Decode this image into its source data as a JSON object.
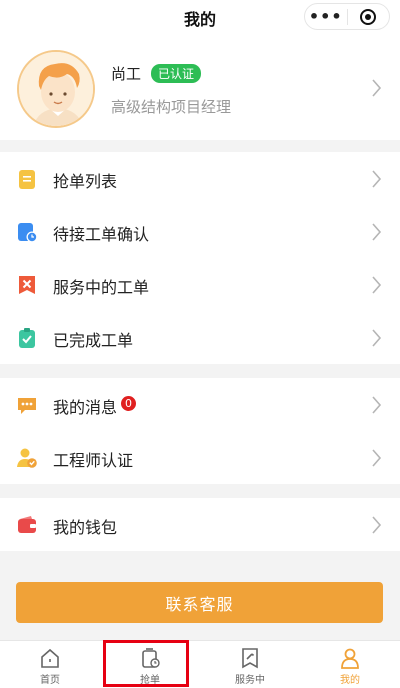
{
  "nav": {
    "title": "我的",
    "more_icon": "more-dots-icon",
    "close_icon": "target-circle-icon"
  },
  "profile": {
    "name": "尚工",
    "badge": "已认证",
    "title": "高级结构项目经理",
    "avatar_icon": "engineer-avatar-icon"
  },
  "menu_group1": [
    {
      "label": "抢单列表",
      "icon": "clipboard-list-icon",
      "color": "#f5c342"
    },
    {
      "label": "待接工单确认",
      "icon": "clock-clipboard-icon",
      "color": "#3b8df1"
    },
    {
      "label": "服务中的工单",
      "icon": "tools-cross-icon",
      "color": "#ee5a3a"
    },
    {
      "label": "已完成工单",
      "icon": "check-clipboard-icon",
      "color": "#3cc6a0"
    }
  ],
  "menu_group2": [
    {
      "label": "我的消息",
      "icon": "message-bubble-icon",
      "color": "#f0a238",
      "badge": "0"
    },
    {
      "label": "工程师认证",
      "icon": "user-verify-icon",
      "color": "#f5c342"
    }
  ],
  "menu_group3": [
    {
      "label": "我的钱包",
      "icon": "wallet-icon",
      "color": "#e94a4a"
    }
  ],
  "service_button": "联系客服",
  "tabs": [
    {
      "label": "首页",
      "icon": "home-icon"
    },
    {
      "label": "抢单",
      "icon": "grab-order-icon"
    },
    {
      "label": "服务中",
      "icon": "service-tools-icon"
    },
    {
      "label": "我的",
      "icon": "user-icon",
      "active": true
    }
  ],
  "colors": {
    "accent": "#f0a238",
    "verified": "#2dbd55",
    "highlight": "#e60012"
  }
}
